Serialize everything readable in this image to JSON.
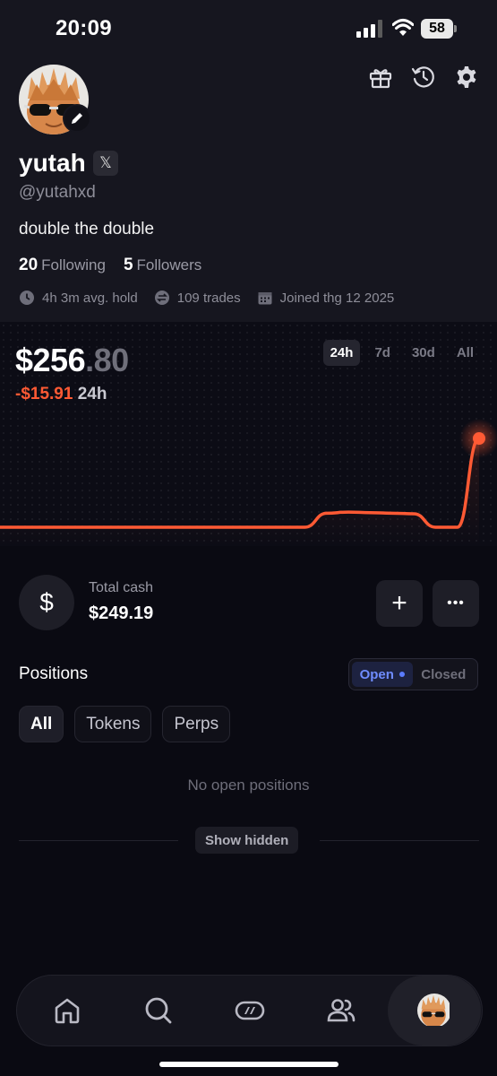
{
  "status": {
    "time": "20:09",
    "battery": "58"
  },
  "profile": {
    "username": "yutah",
    "x_badge": "𝕏",
    "handle": "@yutahxd",
    "bio": "double the double",
    "following_count": "20",
    "following_label": "Following",
    "followers_count": "5",
    "followers_label": "Followers",
    "avg_hold": "4h 3m avg. hold",
    "trades": "109 trades",
    "joined": "Joined thg 12 2025",
    "header_icons": [
      "gift-icon",
      "history-icon",
      "settings-icon"
    ]
  },
  "portfolio": {
    "balance_whole": "$256",
    "balance_decimal": ".80",
    "change": "-$15.91",
    "change_period": "24h",
    "timeframes": [
      "24h",
      "7d",
      "30d",
      "All"
    ],
    "active_timeframe": "24h",
    "line_color": "#ff5a34"
  },
  "chart_data": {
    "type": "line",
    "series": [
      {
        "values": [
          241,
          241,
          241,
          241,
          241,
          241,
          241,
          241,
          241,
          241,
          241,
          241,
          241,
          241,
          241,
          243.5,
          243.7,
          243.6,
          243.5,
          243.4,
          241,
          241,
          256.8
        ]
      }
    ]
  },
  "cash": {
    "label": "Total cash",
    "value": "$249.19",
    "dollar_symbol": "$",
    "add_symbol": "+",
    "more_symbol": "•••"
  },
  "positions": {
    "title": "Positions",
    "toggle_open": "Open",
    "toggle_closed": "Closed",
    "filters": [
      "All",
      "Tokens",
      "Perps"
    ],
    "active_filter": "All",
    "empty_text": "No open positions",
    "show_hidden": "Show hidden"
  },
  "nav": {
    "items": [
      "home-icon",
      "search-icon",
      "trade-icon",
      "community-icon",
      "profile-avatar"
    ],
    "active": "profile-avatar"
  }
}
